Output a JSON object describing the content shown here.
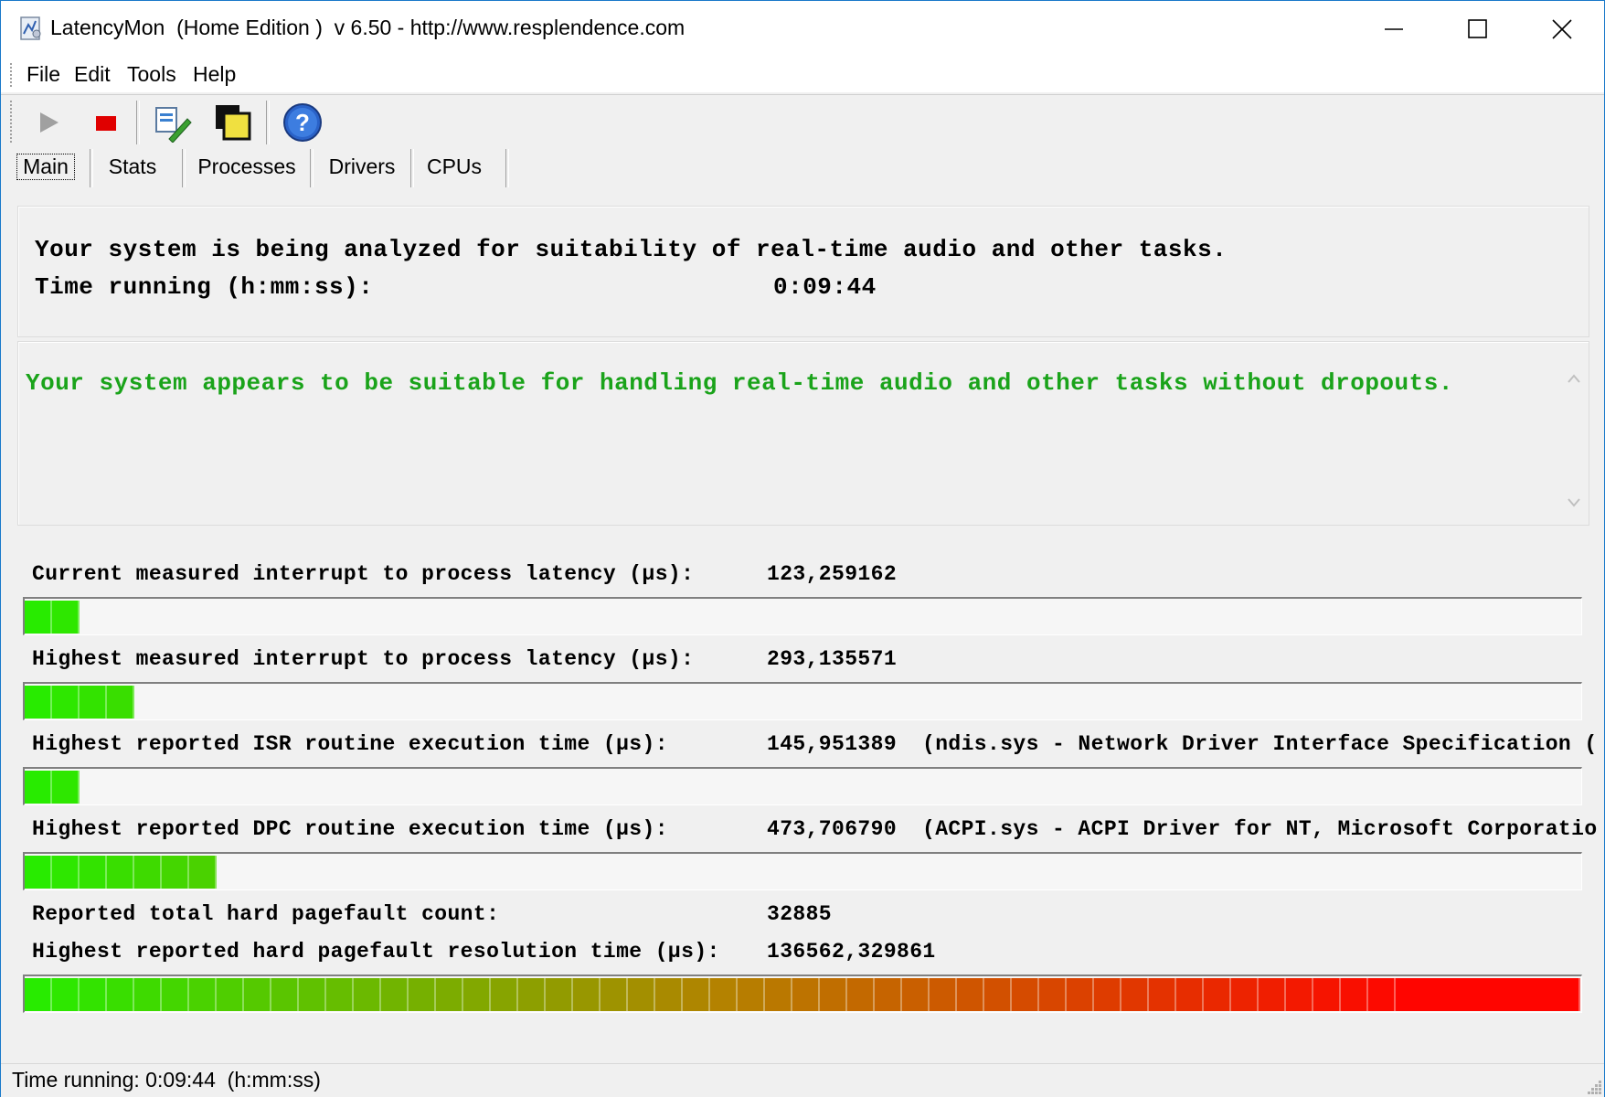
{
  "window": {
    "title": "LatencyMon  (Home Edition )  v 6.50 - http://www.resplendence.com"
  },
  "menu": {
    "items": [
      "File",
      "Edit",
      "Tools",
      "Help"
    ]
  },
  "toolbar": {
    "buttons": [
      "play-icon",
      "stop-icon",
      "report-icon",
      "windows-icon",
      "help-icon"
    ]
  },
  "tabs": {
    "items": [
      "Main",
      "Stats",
      "Processes",
      "Drivers",
      "CPUs"
    ],
    "active": "Main"
  },
  "main": {
    "analysis_line": "Your system is being analyzed for suitability of real-time audio and other tasks.",
    "time_label": "Time running (h:mm:ss):",
    "time_value": "0:09:44",
    "verdict": "Your system appears to be suitable for handling real-time audio and other tasks without dropouts.",
    "verdict_color": "#1aa31a",
    "rows": [
      {
        "label": "Current measured interrupt to process latency (µs):",
        "value": "123,259162",
        "extra": "",
        "bar_segments": 2
      },
      {
        "label": "Highest measured interrupt to process latency (µs):",
        "value": "293,135571",
        "extra": "",
        "bar_segments": 4
      },
      {
        "label": "Highest reported ISR routine execution time (µs):",
        "value": "145,951389",
        "extra": "(ndis.sys - Network Driver Interface Specification (NDIS), Microsoft Corporation)",
        "bar_segments": 2
      },
      {
        "label": "Highest reported DPC routine execution time (µs):",
        "value": "473,706790",
        "extra": "(ACPI.sys - ACPI Driver for NT, Microsoft Corporation)",
        "bar_segments": 7
      }
    ],
    "pagefault_count_label": "Reported total hard pagefault count:",
    "pagefault_count_value": "32885",
    "pagefault_time_label": "Highest reported hard pagefault resolution time (µs):",
    "pagefault_time_value": "136562,329861",
    "pagefault_bar_segments": 51
  },
  "status": {
    "text": "Time running: 0:09:44  (h:mm:ss)"
  }
}
